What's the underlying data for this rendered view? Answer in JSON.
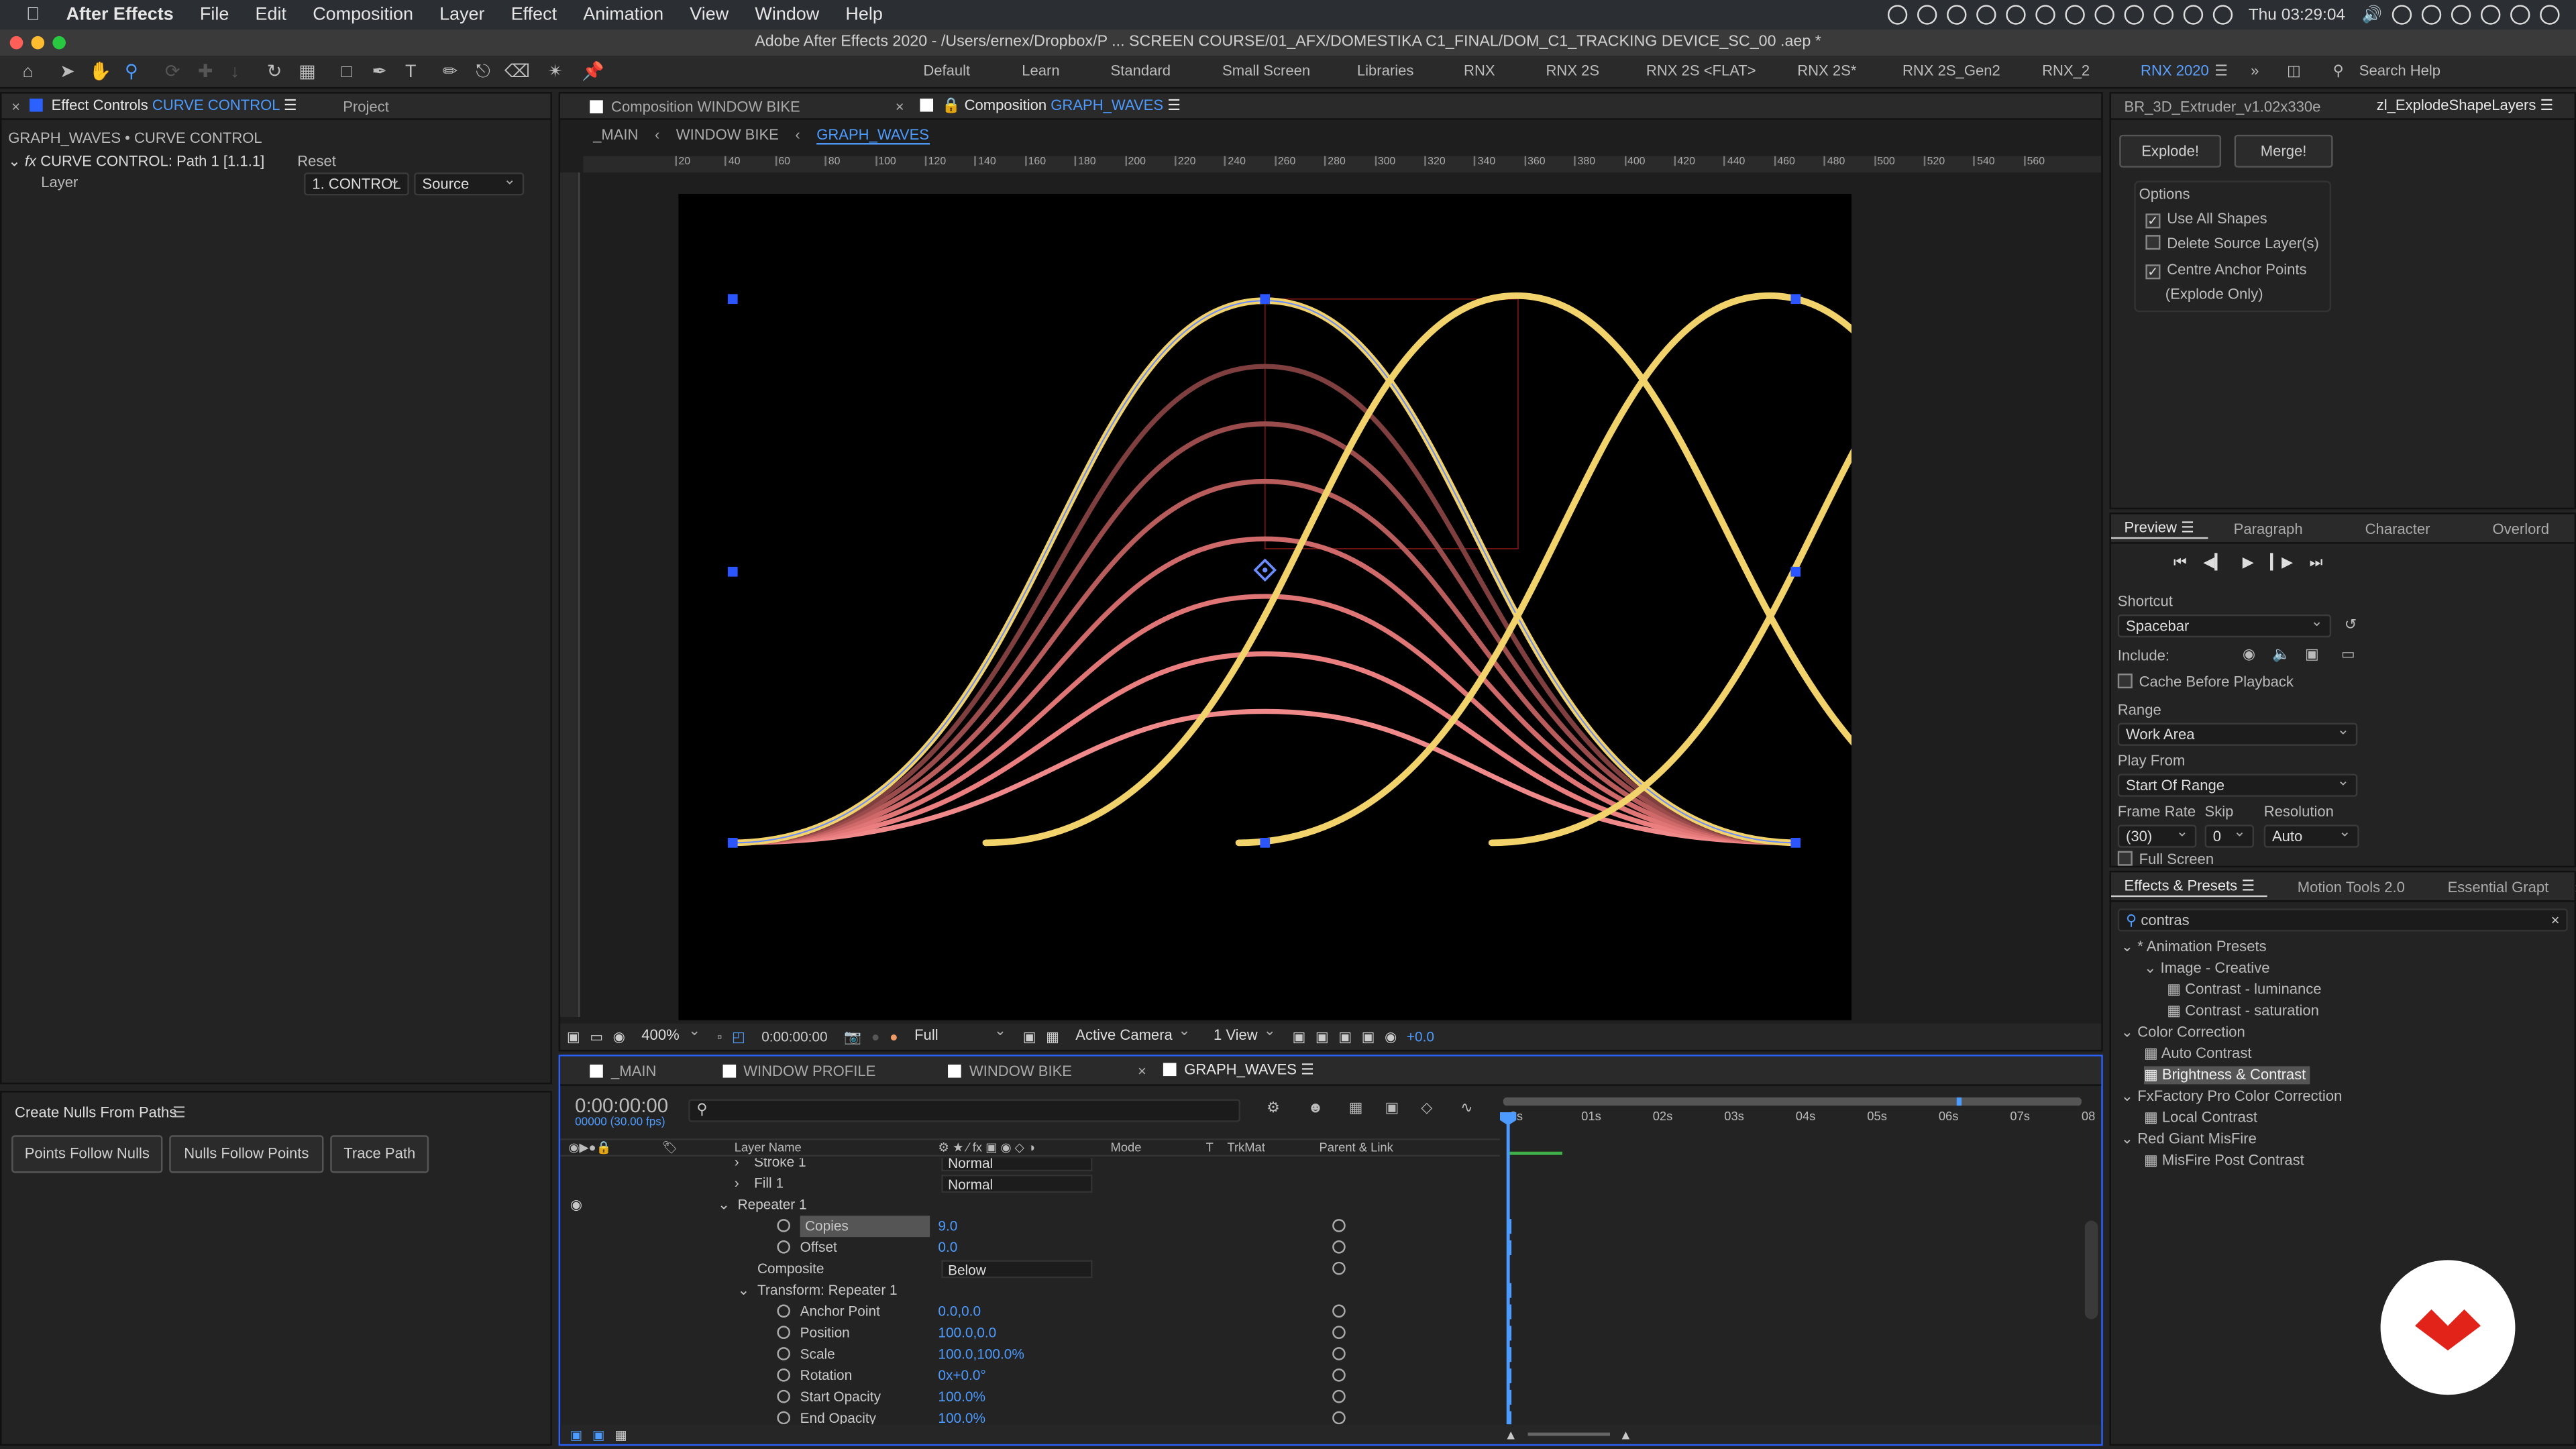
{
  "menubar": {
    "app_name": "After Effects",
    "items": [
      "File",
      "Edit",
      "Composition",
      "Layer",
      "Effect",
      "Animation",
      "View",
      "Window",
      "Help"
    ],
    "clock": "Thu 03:29:04"
  },
  "titlebar": {
    "title": "Adobe After Effects 2020 - /Users/ernex/Dropbox/P ... SCREEN COURSE/01_AFX/DOMESTIKA C1_FINAL/DOM_C1_TRACKING DEVICE_SC_00 .aep *"
  },
  "workspaces": [
    "Default",
    "Learn",
    "Standard",
    "Small Screen",
    "Libraries",
    "RNX",
    "RNX 2S",
    "RNX 2S <FLAT>",
    "RNX 2S*",
    "RNX 2S_Gen2",
    "RNX_2",
    "RNX 2020"
  ],
  "workspace_active": "RNX 2020",
  "search_help": "Search Help",
  "effect_controls": {
    "tab_label": "Effect Controls",
    "tab_target": "CURVE CONTROL",
    "project_tab": "Project",
    "breadcrumb": "GRAPH_WAVES • CURVE CONTROL",
    "effect_name": "CURVE CONTROL: Path 1 [1.1.1]",
    "reset": "Reset",
    "layer_label": "Layer",
    "layer_value": "1. CONTROL",
    "source_value": "Source"
  },
  "create_nulls": {
    "title": "Create Nulls From Paths",
    "buttons": [
      "Points Follow Nulls",
      "Nulls Follow Points",
      "Trace Path"
    ]
  },
  "viewer": {
    "tab_other": "Composition WINDOW BIKE",
    "tab_active_prefix": "Composition",
    "tab_active_name": "GRAPH_WAVES",
    "crumbs": [
      "_MAIN",
      "WINDOW BIKE",
      "GRAPH_WAVES"
    ],
    "ruler_labels": [
      "20",
      "40",
      "60",
      "80",
      "100",
      "120",
      "140",
      "160",
      "180",
      "200",
      "220",
      "240",
      "260",
      "280",
      "300",
      "320",
      "340",
      "360",
      "380",
      "400",
      "420",
      "440",
      "460",
      "480",
      "500",
      "520",
      "540",
      "560"
    ],
    "zoom": "400%",
    "time": "0:00:00:00",
    "resolution": "Full",
    "camera": "Active Camera",
    "views": "1 View",
    "exposure": "+0.0"
  },
  "timeline": {
    "tabs": [
      "_MAIN",
      "WINDOW PROFILE",
      "WINDOW BIKE",
      "GRAPH_WAVES"
    ],
    "active_tab": "GRAPH_WAVES",
    "timecode": "0:00:00:00",
    "frames": "00000 (30.00 fps)",
    "columns": [
      "Layer Name",
      "Mode",
      "T",
      "TrkMat",
      "Parent & Link"
    ],
    "time_labels": [
      "0s",
      "01s",
      "02s",
      "03s",
      "04s",
      "05s",
      "06s",
      "07s",
      "08"
    ],
    "rows": [
      {
        "name": "Stroke 1",
        "value": "Normal"
      },
      {
        "name": "Fill 1",
        "value": "Normal"
      },
      {
        "name": "Repeater 1",
        "value": ""
      },
      {
        "name": "Copies",
        "value": "9.0"
      },
      {
        "name": "Offset",
        "value": "0.0"
      },
      {
        "name": "Composite",
        "value": "Below"
      },
      {
        "name": "Transform: Repeater 1",
        "value": ""
      },
      {
        "name": "Anchor Point",
        "value": "0.0,0.0"
      },
      {
        "name": "Position",
        "value": "100.0,0.0"
      },
      {
        "name": "Scale",
        "value": "100.0,100.0%"
      },
      {
        "name": "Rotation",
        "value": "0x+0.0°"
      },
      {
        "name": "Start Opacity",
        "value": "100.0%"
      },
      {
        "name": "End Opacity",
        "value": "100.0%"
      }
    ]
  },
  "explode": {
    "tab1": "BR_3D_Extruder_v1.02x330e",
    "tab2": "zl_ExplodeShapeLayers",
    "explode_btn": "Explode!",
    "merge_btn": "Merge!",
    "options_label": "Options",
    "opt_use_all": "Use All Shapes",
    "opt_delete": "Delete Source Layer(s)",
    "opt_centre": "Centre Anchor Points",
    "opt_note": "(Explode Only)"
  },
  "preview": {
    "tabs": [
      "Preview",
      "Paragraph",
      "Character",
      "Overlord"
    ],
    "shortcut_label": "Shortcut",
    "shortcut_value": "Spacebar",
    "include_label": "Include:",
    "cache": "Cache Before Playback",
    "range_label": "Range",
    "range_value": "Work Area",
    "play_from_label": "Play From",
    "play_from_value": "Start Of Range",
    "frame_rate_label": "Frame Rate",
    "skip_label": "Skip",
    "resolution_label": "Resolution",
    "frame_rate_value": "(30)",
    "skip_value": "0",
    "resolution_value": "Auto",
    "full_screen": "Full Screen"
  },
  "effects_presets": {
    "tabs": [
      "Effects & Presets",
      "Motion Tools 2.0",
      "Essential Grapt"
    ],
    "search": "contras",
    "tree": [
      {
        "label": "* Animation Presets",
        "level": 0
      },
      {
        "label": "Image - Creative",
        "level": 1
      },
      {
        "label": "Contrast - luminance",
        "level": 2
      },
      {
        "label": "Contrast - saturation",
        "level": 2
      },
      {
        "label": "Color Correction",
        "level": 0
      },
      {
        "label": "Auto Contrast",
        "level": 1
      },
      {
        "label": "Brightness & Contrast",
        "level": 1
      },
      {
        "label": "FxFactory Pro Color Correction",
        "level": 0
      },
      {
        "label": "Local Contrast",
        "level": 1
      },
      {
        "label": "Red Giant MisFire",
        "level": 0
      },
      {
        "label": "MisFire Post Contrast",
        "level": 1
      }
    ]
  },
  "colors": {
    "accent": "#4d9bff",
    "wave": "#f2d26a",
    "ghost": "#e87474",
    "brand": "#e2231a"
  }
}
